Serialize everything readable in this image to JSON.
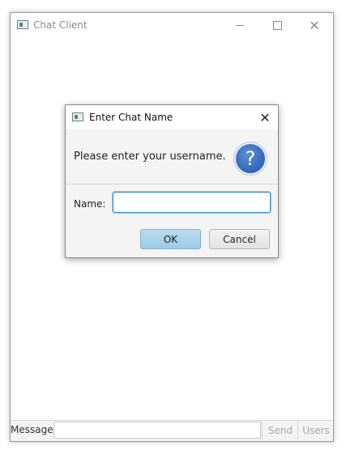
{
  "main_window": {
    "title": "Chat Client",
    "bottom_bar": {
      "message_label": "Message:",
      "message_value": "",
      "send_label": "Send",
      "users_label": "Users"
    }
  },
  "dialog": {
    "title": "Enter Chat Name",
    "header_text": "Please enter your username.",
    "question_glyph": "?",
    "name_label": "Name:",
    "name_value": "",
    "ok_label": "OK",
    "cancel_label": "Cancel",
    "close_glyph": "✕"
  },
  "colors": {
    "ok_button": "#a9d4ec",
    "focus_border": "#2e8bd6",
    "question_icon": "#2f66b8"
  },
  "icons": [
    "app-icon",
    "minimize-icon",
    "maximize-icon",
    "close-icon",
    "question-icon"
  ]
}
